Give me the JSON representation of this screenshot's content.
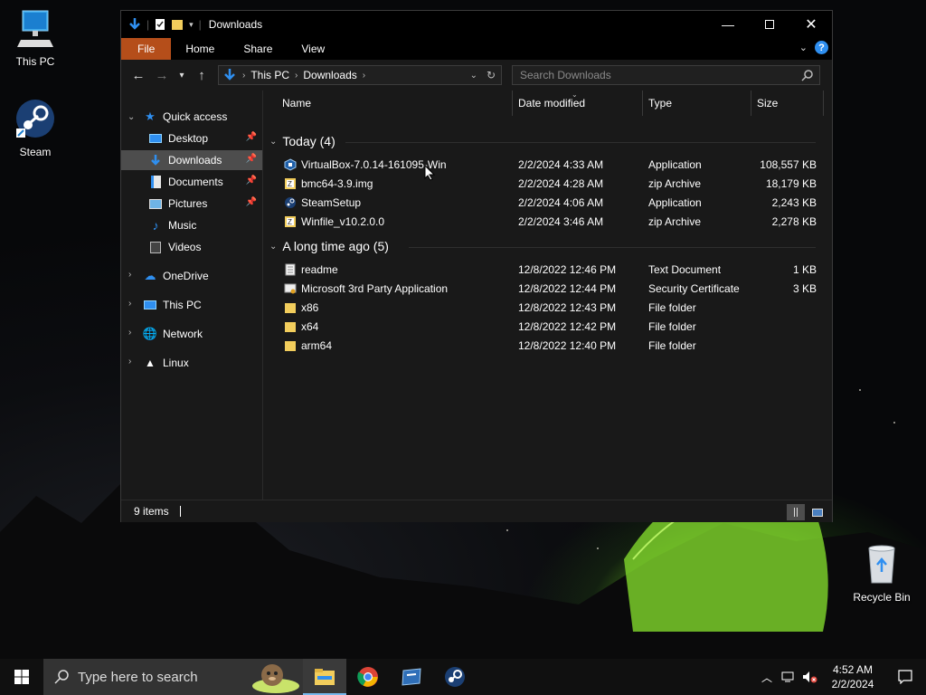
{
  "desktop": {
    "icons": [
      {
        "label": "This PC"
      },
      {
        "label": "Steam"
      },
      {
        "label": "Recycle Bin"
      }
    ]
  },
  "window": {
    "title": "Downloads",
    "ribbon_tabs": [
      "File",
      "Home",
      "Share",
      "View"
    ],
    "breadcrumb": [
      "This PC",
      "Downloads"
    ],
    "search_placeholder": "Search Downloads",
    "columns": [
      "Name",
      "Date modified",
      "Type",
      "Size"
    ],
    "nav": {
      "quick_access": "Quick access",
      "pinned": [
        "Desktop",
        "Downloads",
        "Documents",
        "Pictures"
      ],
      "unpinned": [
        "Music",
        "Videos"
      ],
      "roots": [
        "OneDrive",
        "This PC",
        "Network",
        "Linux"
      ]
    },
    "groups": [
      {
        "label": "Today (4)",
        "files": [
          {
            "name": "VirtualBox-7.0.14-161095-Win",
            "date": "2/2/2024 4:33 AM",
            "type": "Application",
            "size": "108,557 KB",
            "icon": "virtualbox-icon"
          },
          {
            "name": "bmc64-3.9.img",
            "date": "2/2/2024 4:28 AM",
            "type": "zip Archive",
            "size": "18,179 KB",
            "icon": "archive-icon"
          },
          {
            "name": "SteamSetup",
            "date": "2/2/2024 4:06 AM",
            "type": "Application",
            "size": "2,243 KB",
            "icon": "steam-setup-icon"
          },
          {
            "name": "Winfile_v10.2.0.0",
            "date": "2/2/2024 3:46 AM",
            "type": "zip Archive",
            "size": "2,278 KB",
            "icon": "archive-icon"
          }
        ]
      },
      {
        "label": "A long time ago (5)",
        "files": [
          {
            "name": "readme",
            "date": "12/8/2022 12:46 PM",
            "type": "Text Document",
            "size": "1 KB",
            "icon": "text-document-icon"
          },
          {
            "name": "Microsoft 3rd Party Application",
            "date": "12/8/2022 12:44 PM",
            "type": "Security Certificate",
            "size": "3 KB",
            "icon": "certificate-icon"
          },
          {
            "name": "x86",
            "date": "12/8/2022 12:43 PM",
            "type": "File folder",
            "size": "",
            "icon": "folder-icon"
          },
          {
            "name": "x64",
            "date": "12/8/2022 12:42 PM",
            "type": "File folder",
            "size": "",
            "icon": "folder-icon"
          },
          {
            "name": "arm64",
            "date": "12/8/2022 12:40 PM",
            "type": "File folder",
            "size": "",
            "icon": "folder-icon"
          }
        ]
      }
    ],
    "status": "9 items"
  },
  "taskbar": {
    "search_placeholder": "Type here to search",
    "time": "4:52 AM",
    "date": "2/2/2024"
  },
  "colors": {
    "ribbon_file_tab": "#b54e1a",
    "selected_nav": "#4d4d4d",
    "window_bg": "#191919",
    "accent_blue": "#2f8ff0",
    "folder_yellow": "#f2cd5c"
  }
}
